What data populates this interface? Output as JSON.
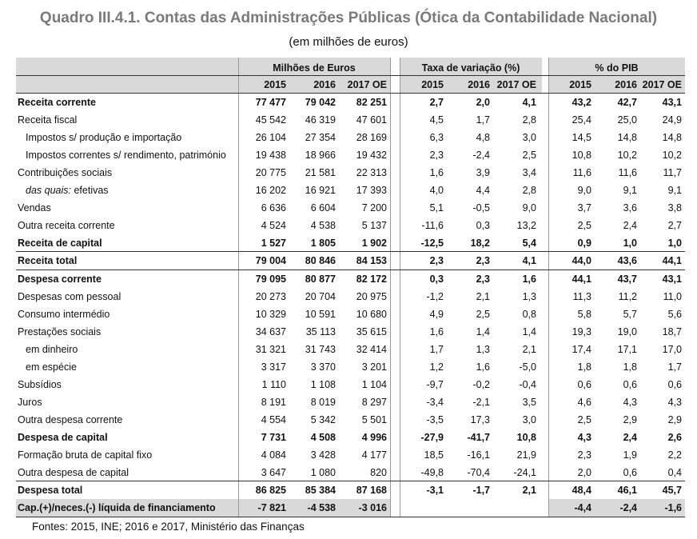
{
  "title": "Quadro III.4.1. Contas das Administrações Públicas (Ótica da Contabilidade Nacional)",
  "subtitle": "(em milhões de euros)",
  "groups": [
    "Milhões de Euros",
    "Taxa de variação (%)",
    "% do PIB"
  ],
  "years": [
    "2015",
    "2016",
    "2017 OE"
  ],
  "rows": [
    {
      "label": "Receita corrente",
      "bold": true,
      "vals": [
        "77 477",
        "79 042",
        "82 251",
        "2,7",
        "2,0",
        "4,1",
        "43,2",
        "42,7",
        "43,1"
      ]
    },
    {
      "label": "Receita fiscal",
      "vals": [
        "45 542",
        "46 319",
        "47 601",
        "4,5",
        "1,7",
        "2,8",
        "25,4",
        "25,0",
        "24,9"
      ]
    },
    {
      "label": "Impostos s/ produção e importação",
      "indent": 1,
      "vals": [
        "26 104",
        "27 354",
        "28 169",
        "6,3",
        "4,8",
        "3,0",
        "14,5",
        "14,8",
        "14,8"
      ]
    },
    {
      "label": "Impostos correntes s/ rendimento, património",
      "indent": 1,
      "vals": [
        "19 438",
        "18 966",
        "19 432",
        "2,3",
        "-2,4",
        "2,5",
        "10,8",
        "10,2",
        "10,2"
      ]
    },
    {
      "label": "Contribuições sociais",
      "vals": [
        "20 775",
        "21 581",
        "22 313",
        "1,6",
        "3,9",
        "3,4",
        "11,6",
        "11,6",
        "11,7"
      ]
    },
    {
      "label": "das quais:",
      "label2": "efetivas",
      "indent": 1,
      "vals": [
        "16 202",
        "16 921",
        "17 393",
        "4,0",
        "4,4",
        "2,8",
        "9,0",
        "9,1",
        "9,1"
      ]
    },
    {
      "label": "Vendas",
      "vals": [
        "6 636",
        "6 604",
        "7 200",
        "5,1",
        "-0,5",
        "9,0",
        "3,7",
        "3,6",
        "3,8"
      ]
    },
    {
      "label": "Outra receita corrente",
      "vals": [
        "4 524",
        "4 538",
        "5 137",
        "-11,6",
        "0,3",
        "13,2",
        "2,5",
        "2,4",
        "2,7"
      ]
    },
    {
      "label": "Receita de capital",
      "bold": true,
      "vals": [
        "1 527",
        "1 805",
        "1 902",
        "-12,5",
        "18,2",
        "5,4",
        "0,9",
        "1,0",
        "1,0"
      ]
    },
    {
      "label": "Receita total",
      "bold": true,
      "vals": [
        "79 004",
        "80 846",
        "84 153",
        "2,3",
        "2,3",
        "4,1",
        "44,0",
        "43,6",
        "44,1"
      ]
    },
    {
      "label": "Despesa corrente",
      "bold": true,
      "vals": [
        "79 095",
        "80 877",
        "82 172",
        "0,3",
        "2,3",
        "1,6",
        "44,1",
        "43,7",
        "43,1"
      ]
    },
    {
      "label": "Despesas com pessoal",
      "vals": [
        "20 273",
        "20 704",
        "20 975",
        "-1,2",
        "2,1",
        "1,3",
        "11,3",
        "11,2",
        "11,0"
      ]
    },
    {
      "label": "Consumo intermédio",
      "vals": [
        "10 329",
        "10 591",
        "10 680",
        "4,9",
        "2,5",
        "0,8",
        "5,8",
        "5,7",
        "5,6"
      ]
    },
    {
      "label": "Prestações sociais",
      "vals": [
        "34 637",
        "35 113",
        "35 615",
        "1,6",
        "1,4",
        "1,4",
        "19,3",
        "19,0",
        "18,7"
      ]
    },
    {
      "label": "em dinheiro",
      "indent": 1,
      "vals": [
        "31 321",
        "31 743",
        "32 414",
        "1,7",
        "1,3",
        "2,1",
        "17,4",
        "17,1",
        "17,0"
      ]
    },
    {
      "label": "em espécie",
      "indent": 1,
      "vals": [
        "3 317",
        "3 370",
        "3 201",
        "1,2",
        "1,6",
        "-5,0",
        "1,8",
        "1,8",
        "1,7"
      ]
    },
    {
      "label": "Subsídios",
      "vals": [
        "1 110",
        "1 108",
        "1 104",
        "-9,7",
        "-0,2",
        "-0,4",
        "0,6",
        "0,6",
        "0,6"
      ]
    },
    {
      "label": "Juros",
      "vals": [
        "8 191",
        "8 019",
        "8 297",
        "-3,4",
        "-2,1",
        "3,5",
        "4,6",
        "4,3",
        "4,3"
      ]
    },
    {
      "label": "Outra despesa corrente",
      "vals": [
        "4 554",
        "5 342",
        "5 501",
        "-3,5",
        "17,3",
        "3,0",
        "2,5",
        "2,9",
        "2,9"
      ]
    },
    {
      "label": "Despesa de capital",
      "bold": true,
      "vals": [
        "7 731",
        "4 508",
        "4 996",
        "-27,9",
        "-41,7",
        "10,8",
        "4,3",
        "2,4",
        "2,6"
      ]
    },
    {
      "label": "Formação bruta de capital fixo",
      "vals": [
        "4 084",
        "3 428",
        "4 177",
        "18,5",
        "-16,1",
        "21,9",
        "2,3",
        "1,9",
        "2,2"
      ]
    },
    {
      "label": "Outra despesa de capital",
      "vals": [
        "3 647",
        "1 080",
        "820",
        "-49,8",
        "-70,4",
        "-24,1",
        "2,0",
        "0,6",
        "0,4"
      ]
    },
    {
      "label": "Despesa total",
      "bold": true,
      "vals": [
        "86 825",
        "85 384",
        "87 168",
        "-3,1",
        "-1,7",
        "2,1",
        "48,4",
        "46,1",
        "45,7"
      ]
    },
    {
      "label": "Cap.(+)/neces.(-) líquida de financiamento",
      "bold": true,
      "shaded": true,
      "vals": [
        "-7 821",
        "-4 538",
        "-3 016",
        "",
        "",
        "",
        "-4,4",
        "-2,4",
        "-1,6"
      ]
    }
  ],
  "source": "Fontes: 2015, INE; 2016 e 2017, Ministério das Finanças"
}
